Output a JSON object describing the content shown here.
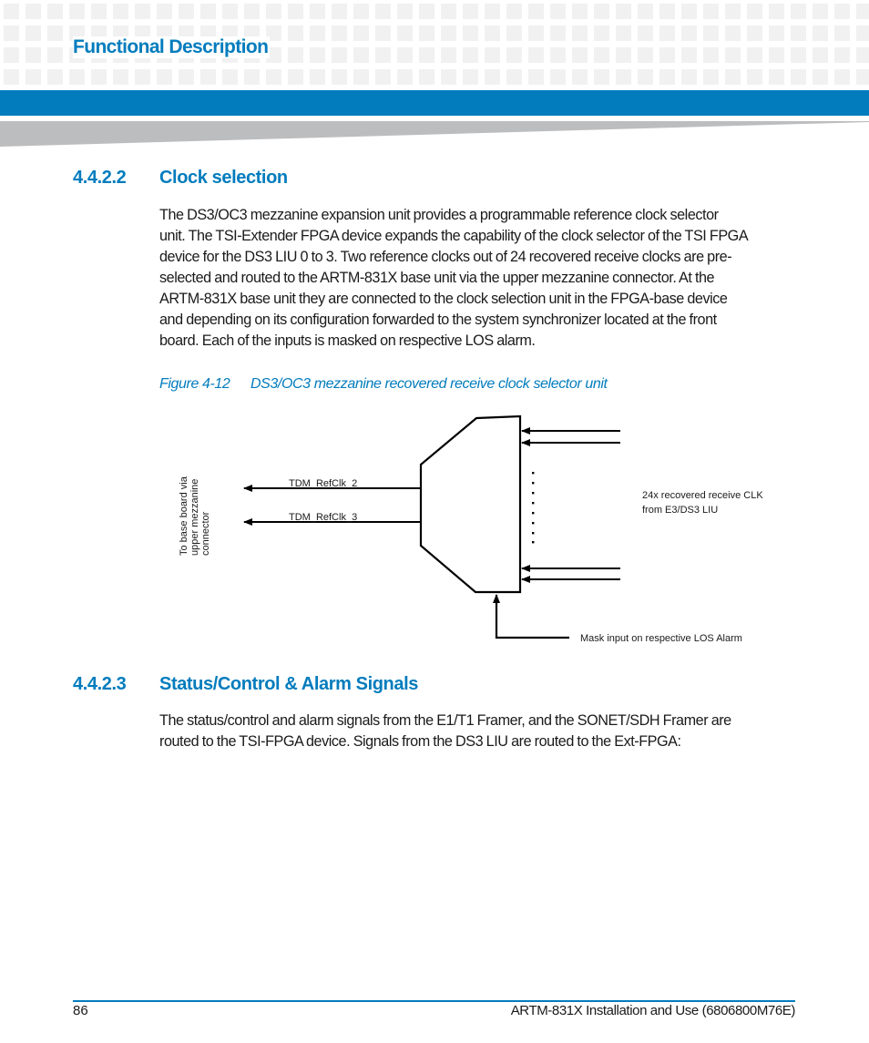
{
  "header": {
    "chapter_title": "Functional Description",
    "accent_color": "#027cbd"
  },
  "sections": [
    {
      "number": "4.4.2.2",
      "title": "Clock selection",
      "paragraph_lines": [
        "The DS3/OC3 mezzanine expansion unit provides a programmable reference clock selector",
        "unit. The TSI-Extender FPGA device expands the capability of the clock selector of the TSI FPGA",
        "device for the DS3 LIU 0 to 3. Two reference clocks out of 24 recovered receive clocks are pre-",
        "selected and routed to the ARTM-831X base unit via the upper mezzanine connector. At the",
        "ARTM-831X base unit they are connected to the clock selection unit in the FPGA-base device",
        "and depending on its configuration forwarded to the system synchronizer located at the front",
        "board. Each of the inputs is masked on respective LOS alarm."
      ]
    },
    {
      "number": "4.4.2.3",
      "title": "Status/Control & Alarm Signals",
      "paragraph_lines": [
        "The status/control and alarm signals from the E1/T1 Framer, and the SONET/SDH Framer are",
        "routed to the TSI-FPGA device. Signals from the DS3 LIU are routed to the Ext-FPGA:"
      ]
    }
  ],
  "figure": {
    "number": "Figure 4-12",
    "caption": "DS3/OC3 mezzanine recovered receive clock selector unit",
    "labels": {
      "destination_lines": [
        "To  base board via",
        "upper mezzanine",
        "connector"
      ],
      "output_1": "TDM_RefClk_2",
      "output_2": "TDM_RefClk_3",
      "inputs_line_1": "24x recovered receive CLK",
      "inputs_line_2": "from E3/DS3 LIU",
      "mask": "Mask input on respective LOS Alarm"
    }
  },
  "footer": {
    "page_number": "86",
    "document_title": "ARTM-831X Installation and Use (6806800M76E)"
  }
}
